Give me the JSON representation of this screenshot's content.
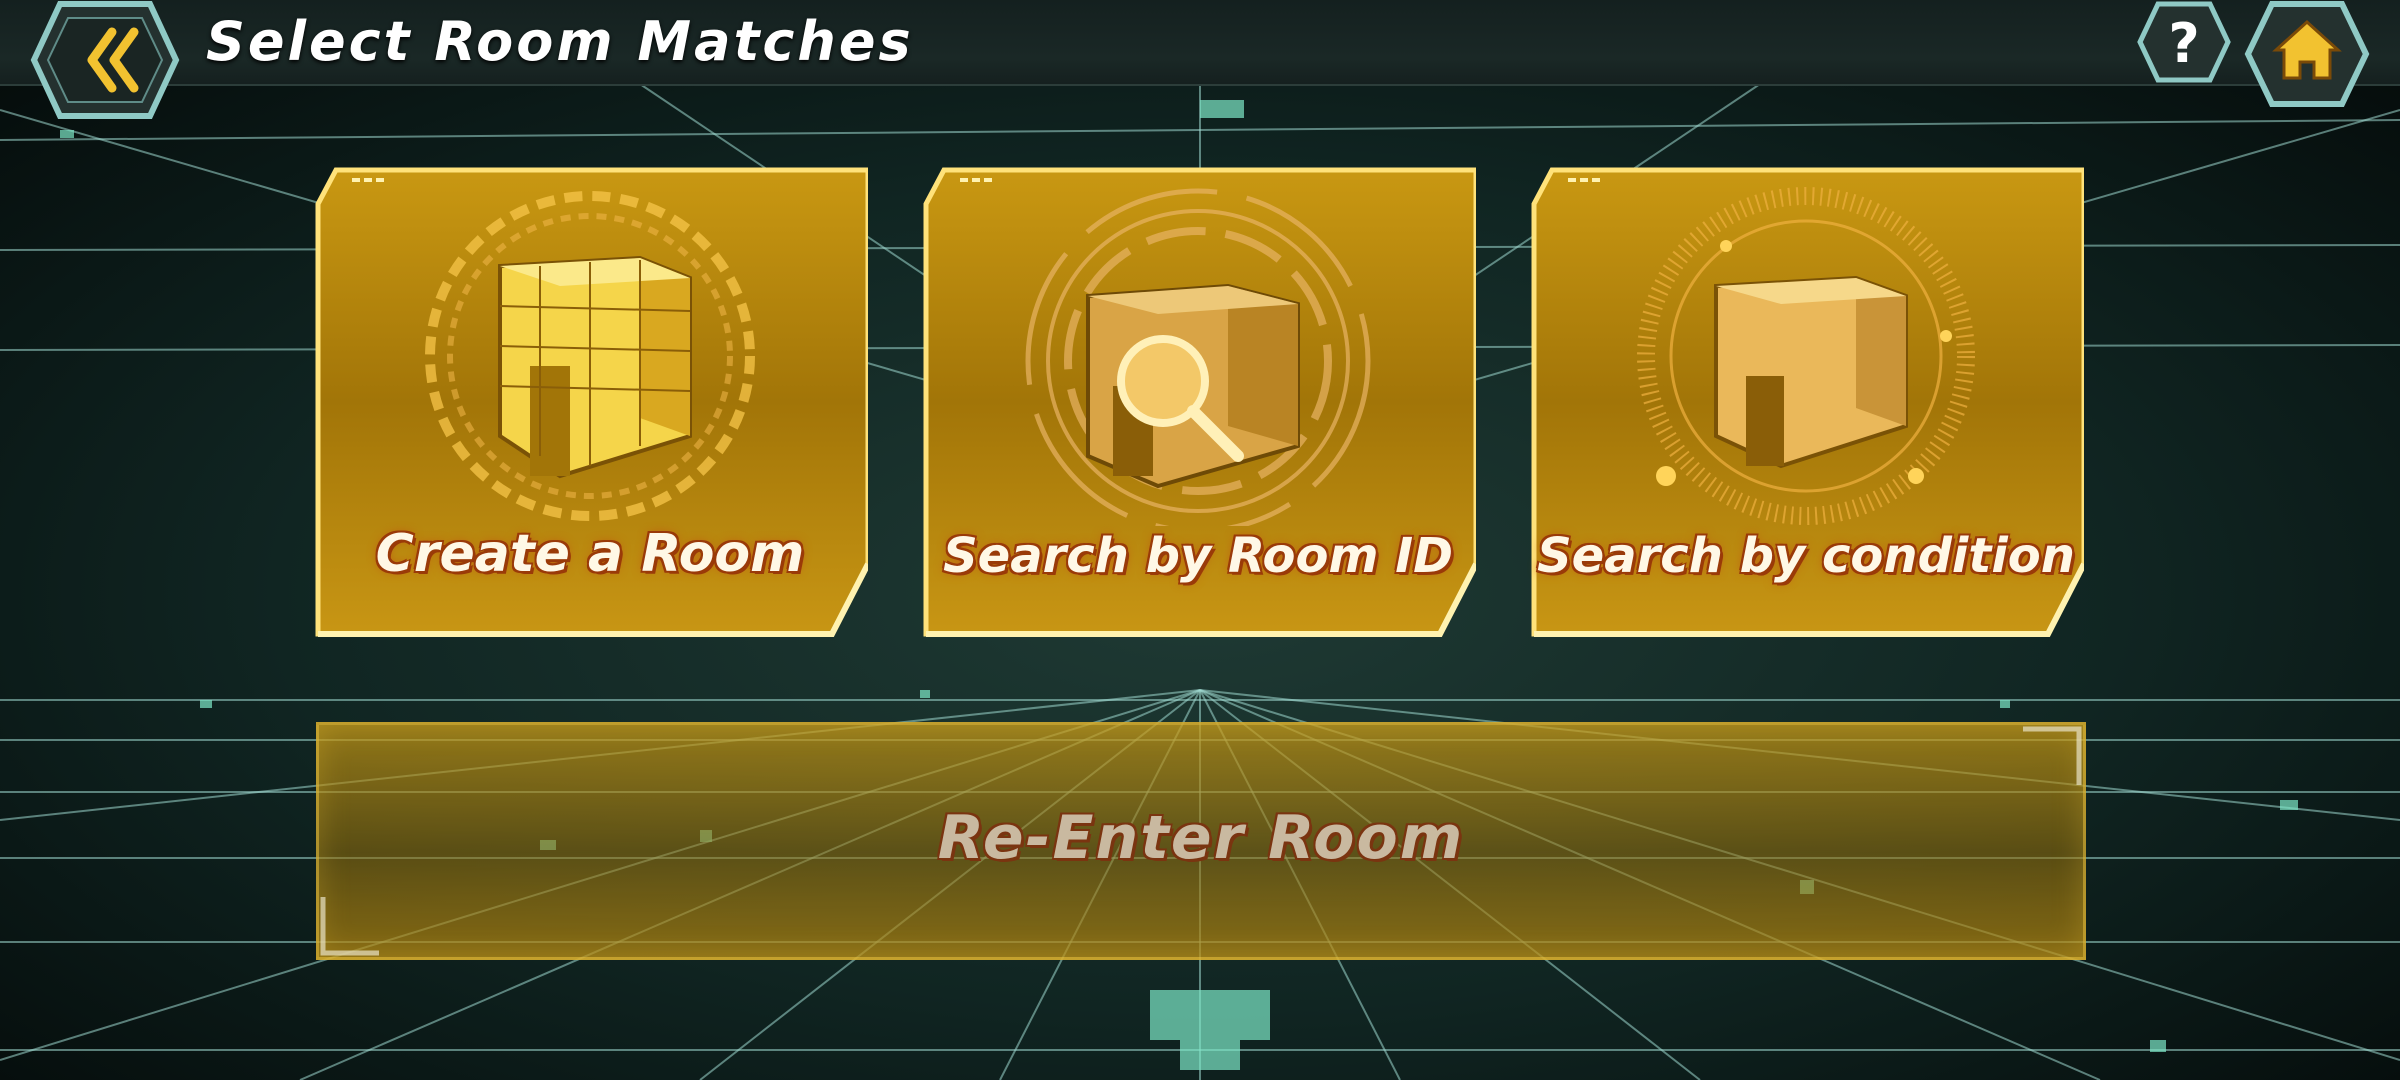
{
  "header": {
    "title": "Select Room Matches",
    "back_icon": "chevron-left-icon",
    "help_icon": "question-mark-icon",
    "home_icon": "home-icon"
  },
  "menu": {
    "cards": [
      {
        "label": "Create a Room",
        "icon": "honeycomb-cube-icon"
      },
      {
        "label": "Search by Room ID",
        "icon": "magnifier-cube-icon"
      },
      {
        "label": "Search by condition",
        "icon": "radar-cube-icon"
      }
    ],
    "reenter_label": "Re-Enter Room",
    "reenter_state": "disabled"
  },
  "colors": {
    "accent_gold": "#f2c230",
    "card_fill": "#b88a12",
    "label_outline": "#9a3a08",
    "grid": "#9fd9cf",
    "topbar": "#1a2826",
    "hex_button_border": "#8fc9c5"
  }
}
